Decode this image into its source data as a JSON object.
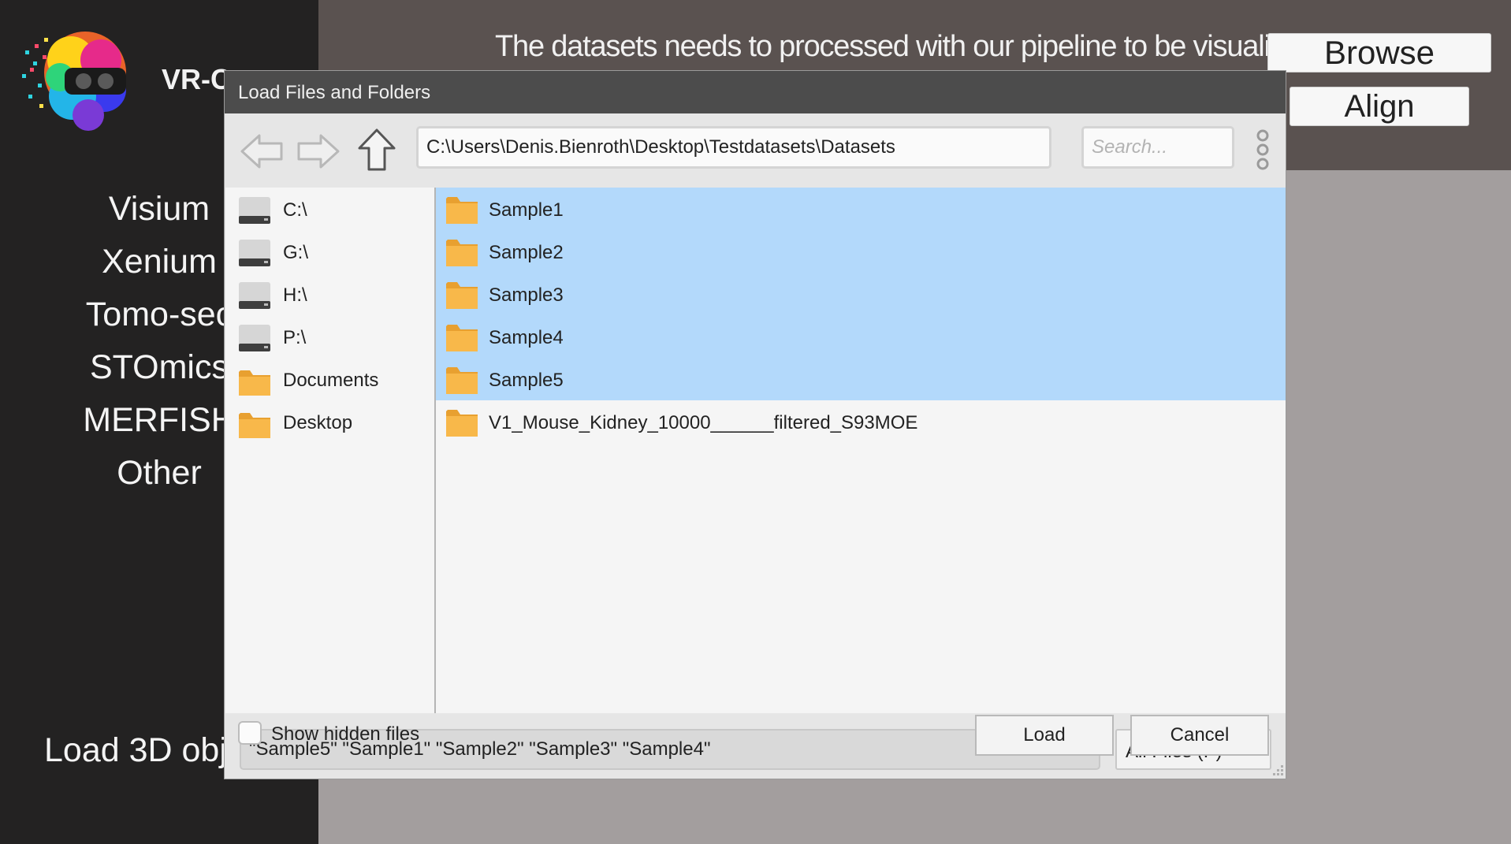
{
  "app": {
    "title": "VR-C",
    "datatypes": [
      "Visium",
      "Xenium",
      "Tomo-sec",
      "STOmics",
      "MERFISH",
      "Other"
    ],
    "load_3d_label": "Load 3D obj",
    "info_text": "The datasets needs to processed with our pipeline to be visualized",
    "browse_label": "Browse",
    "align_label": "Align"
  },
  "dialog": {
    "title": "Load Files and Folders",
    "path": "C:\\Users\\Denis.Bienroth\\Desktop\\Testdatasets\\Datasets",
    "search_placeholder": "Search...",
    "places": [
      {
        "label": "C:\\",
        "icon": "drive-icon"
      },
      {
        "label": "G:\\",
        "icon": "drive-icon"
      },
      {
        "label": "H:\\",
        "icon": "drive-icon"
      },
      {
        "label": "P:\\",
        "icon": "drive-icon"
      },
      {
        "label": "Documents",
        "icon": "folder-icon"
      },
      {
        "label": "Desktop",
        "icon": "folder-icon"
      }
    ],
    "files": [
      {
        "label": "Sample1",
        "selected": true
      },
      {
        "label": "Sample2",
        "selected": true
      },
      {
        "label": "Sample3",
        "selected": true
      },
      {
        "label": "Sample4",
        "selected": true
      },
      {
        "label": "Sample5",
        "selected": true
      },
      {
        "label": "V1_Mouse_Kidney_10000______filtered_S93MOE",
        "selected": false
      }
    ],
    "filename_value": "\"Sample5\" \"Sample1\" \"Sample2\" \"Sample3\" \"Sample4\"",
    "filter_label": "All Files (.*)",
    "show_hidden_label": "Show hidden files",
    "show_hidden_checked": false,
    "load_label": "Load",
    "cancel_label": "Cancel"
  },
  "colors": {
    "selection": "#b3d9fb",
    "folder": "#f8b84a",
    "titlebar": "#4c4c4c"
  }
}
